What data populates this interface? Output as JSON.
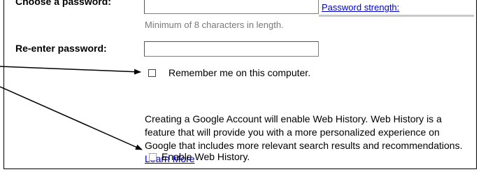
{
  "form": {
    "password_label": "Choose a password:",
    "password_value": "",
    "password_strength_link": "Password strength:",
    "password_hint": "Minimum of 8 characters in length.",
    "reenter_label": "Re-enter password:",
    "reenter_value": "",
    "remember_label": "Remember me on this computer.",
    "remember_checked": false,
    "web_history_text": "Creating a Google Account will enable Web History. Web History is a feature that will provide you with a more personalized experience on Google that includes more relevant search results and recommendations.",
    "learn_more_link": "Learn More",
    "enable_history_label": "Enable Web History.",
    "enable_history_checked": false
  }
}
